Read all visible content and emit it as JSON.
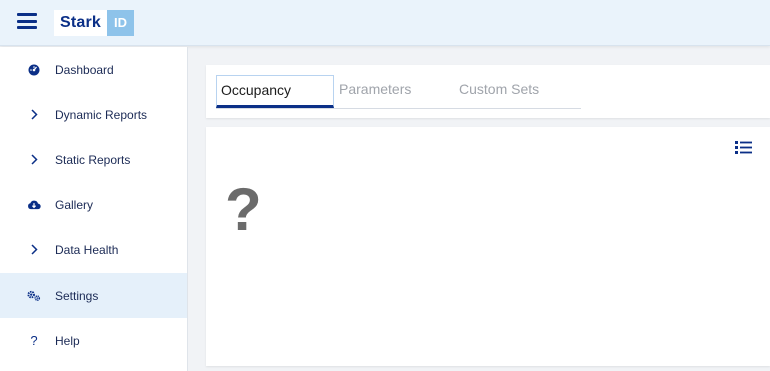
{
  "header": {
    "logo_text": "Stark",
    "logo_badge": "ID"
  },
  "sidebar": {
    "items": [
      {
        "label": "Dashboard",
        "icon": "dashboard-icon"
      },
      {
        "label": "Dynamic Reports",
        "icon": "chevron-right-icon"
      },
      {
        "label": "Static Reports",
        "icon": "chevron-right-icon"
      },
      {
        "label": "Gallery",
        "icon": "cloud-download-icon"
      },
      {
        "label": "Data Health",
        "icon": "chevron-right-icon"
      },
      {
        "label": "Settings",
        "icon": "gears-icon",
        "active": true
      },
      {
        "label": "Help",
        "icon": "question-icon"
      }
    ]
  },
  "tabs": [
    {
      "label": "Occupancy",
      "active": true
    },
    {
      "label": "Parameters"
    },
    {
      "label": "Custom Sets"
    }
  ],
  "card": {
    "placeholder": "?"
  },
  "colors": {
    "brand": "#0b2f87",
    "header_bg": "#eaf3fb",
    "active_bg": "#e5f0fa"
  }
}
